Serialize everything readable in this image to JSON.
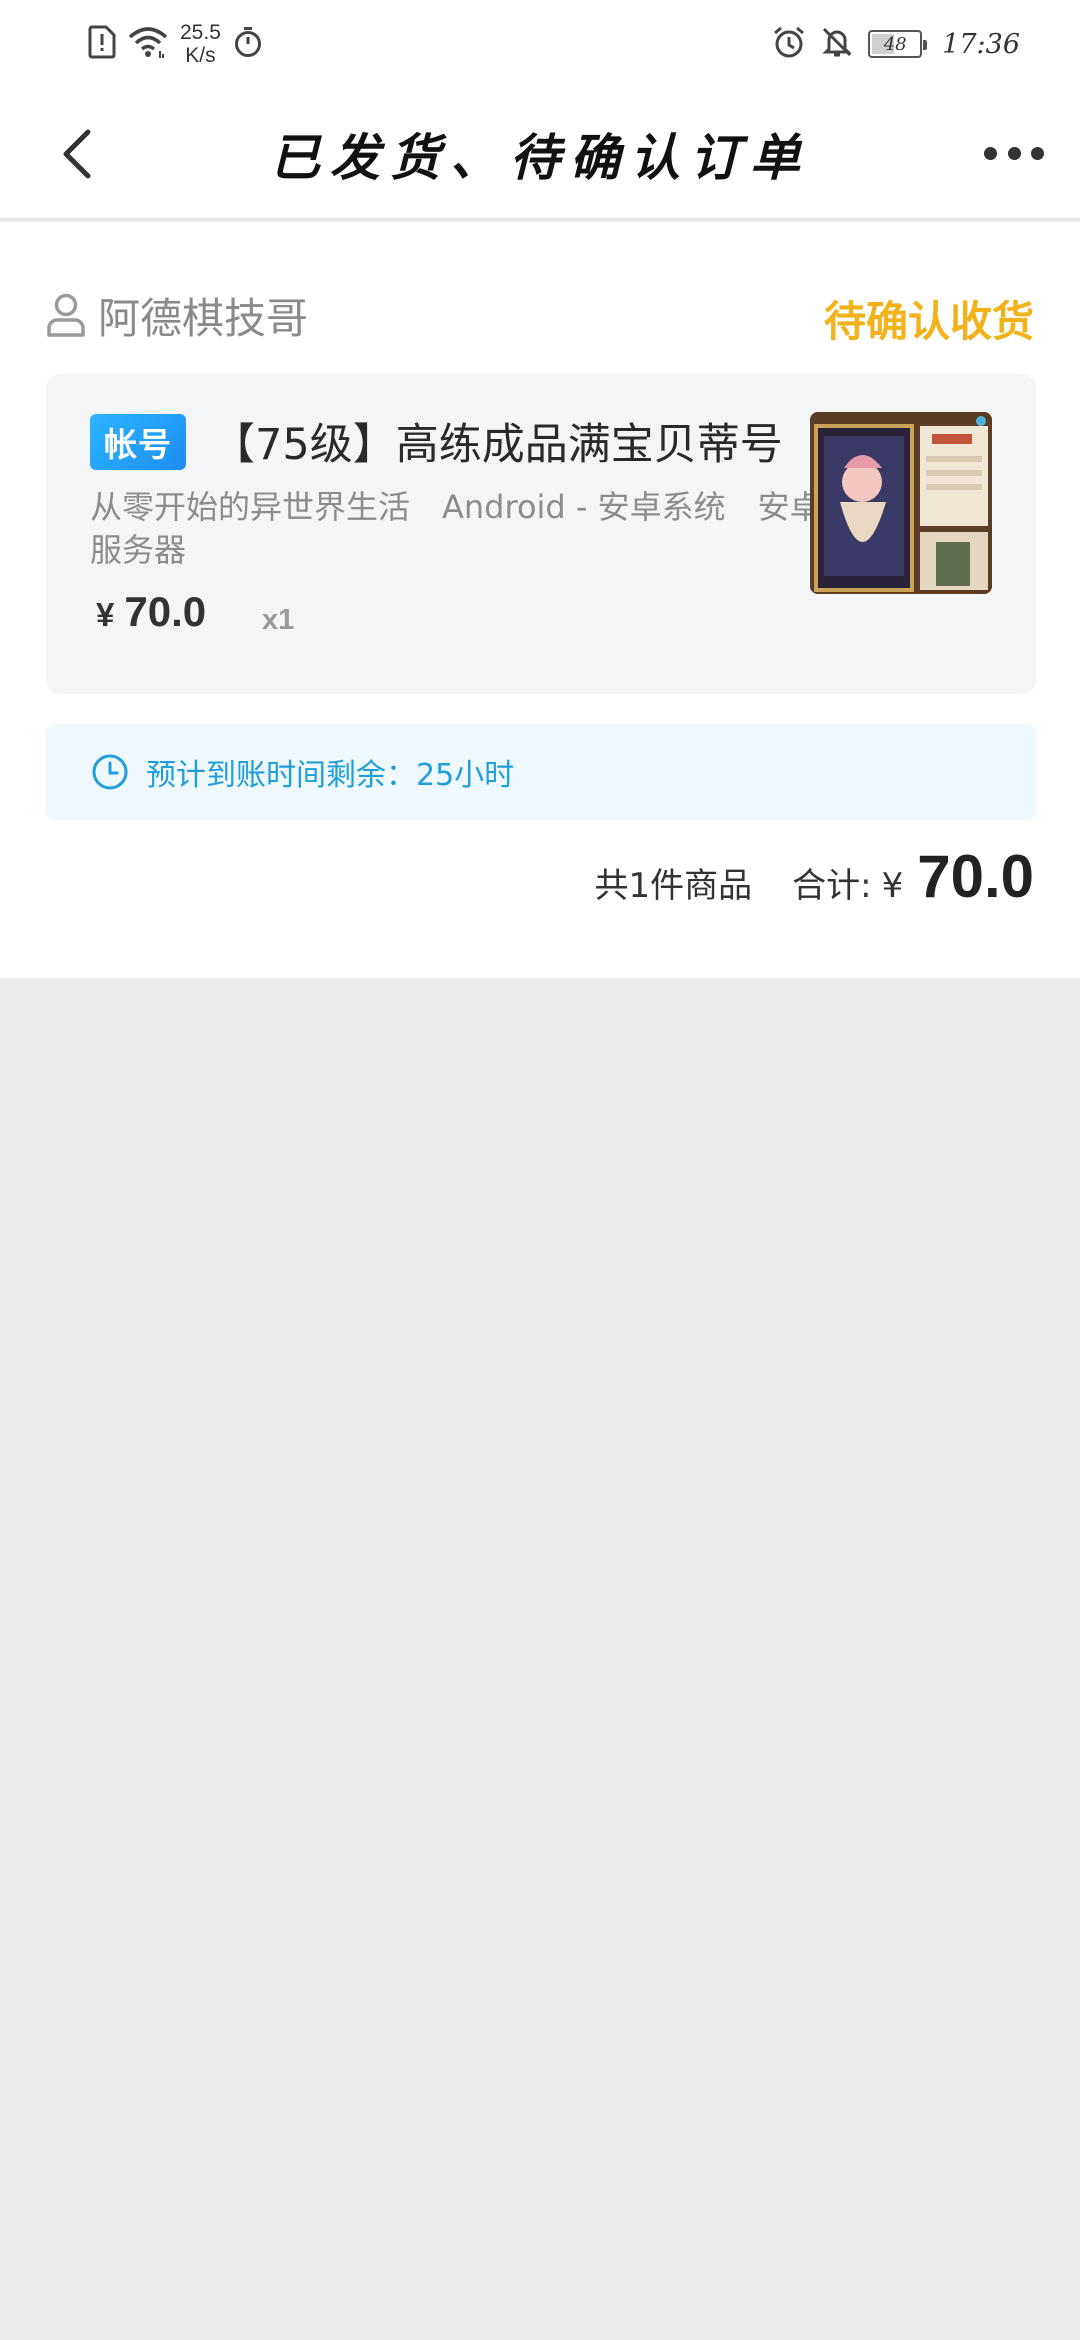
{
  "status_bar": {
    "net_speed_value": "25.5",
    "net_speed_unit": "K/s",
    "battery": "48",
    "battery_level": 0.48,
    "time": "17:36",
    "icons": [
      "sim-alert-icon",
      "wifi-icon",
      "timer-icon",
      "alarm-icon",
      "mute-icon",
      "battery-icon"
    ]
  },
  "nav": {
    "title": "已发货、待确认订单",
    "back_icon": "chevron-left-icon",
    "more_icon": "more-dots-icon"
  },
  "order": {
    "seller_name": "阿德棋技哥",
    "status": "待确认收货",
    "status_color": "#f2b21b",
    "product": {
      "tag": "帐号",
      "title": "【75级】高练成品满宝贝蒂号",
      "description": "从零开始的异世界生活　Android - 安卓系统　安卓服务器",
      "price_symbol": "¥",
      "price": "70.0",
      "quantity": "x1"
    },
    "notice": "预计到账时间剩余：25小时",
    "summary": {
      "count_text": "共1件商品",
      "total_label": "合计:",
      "total_symbol": "¥",
      "total_value": "70.0"
    }
  }
}
